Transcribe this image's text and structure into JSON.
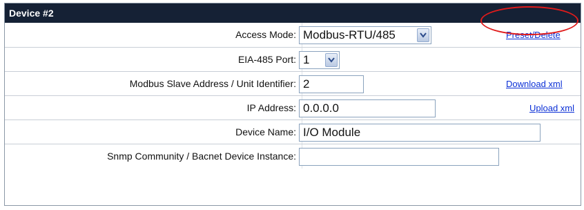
{
  "panel": {
    "title": "Device #2"
  },
  "fields": {
    "access_mode": {
      "label": "Access Mode:",
      "value": "Modbus-RTU/485"
    },
    "eia_port": {
      "label": "EIA-485 Port:",
      "value": "1"
    },
    "slave_address": {
      "label": "Modbus Slave Address / Unit Identifier:",
      "value": "2"
    },
    "ip_address": {
      "label": "IP Address:",
      "value": "0.0.0.0"
    },
    "device_name": {
      "label": "Device Name:",
      "value": "I/O Module"
    },
    "snmp_community": {
      "label": "Snmp Community / Bacnet Device Instance:",
      "value": ""
    }
  },
  "links": {
    "preset_delete": "Preset/Delete",
    "download_xml": "Download xml",
    "upload_xml": "Upload xml"
  },
  "annotation": {
    "color": "#e01b1b"
  }
}
